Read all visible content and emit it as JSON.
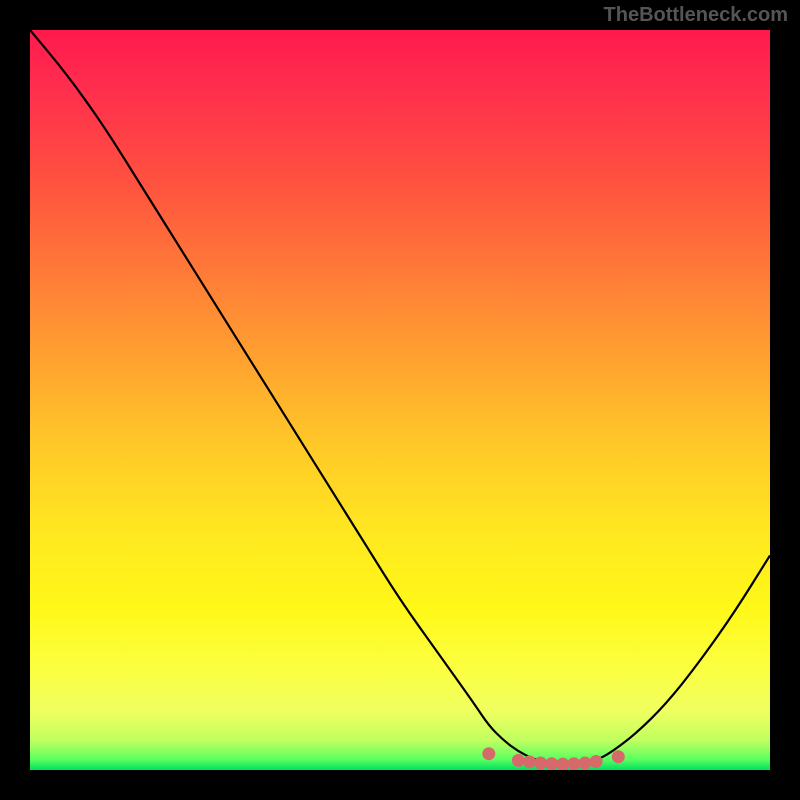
{
  "watermark": "TheBottleneck.com",
  "chart_data": {
    "type": "line",
    "title": "",
    "xlabel": "",
    "ylabel": "",
    "xlim": [
      0,
      100
    ],
    "ylim": [
      0,
      100
    ],
    "series": [
      {
        "name": "bottleneck-curve",
        "x": [
          0,
          5,
          10,
          15,
          20,
          25,
          30,
          35,
          40,
          45,
          50,
          55,
          60,
          62,
          64,
          66,
          68,
          70,
          72,
          74,
          76,
          78,
          82,
          86,
          90,
          95,
          100
        ],
        "values": [
          100,
          94,
          87,
          79,
          71,
          63,
          55,
          47,
          39,
          31,
          23,
          16,
          9,
          6,
          4,
          2.5,
          1.5,
          1,
          0.8,
          0.9,
          1.2,
          2,
          5,
          9,
          14,
          21,
          29
        ]
      }
    ],
    "marker_points": {
      "name": "optimal-range",
      "color": "#d66a6a",
      "x": [
        62,
        66,
        67.5,
        69,
        70.5,
        72,
        73.5,
        75,
        76.5,
        79.5
      ],
      "values": [
        2.2,
        1.3,
        1.1,
        0.95,
        0.85,
        0.8,
        0.85,
        0.95,
        1.15,
        1.8
      ]
    },
    "background_gradient": {
      "type": "vertical",
      "stops": [
        {
          "pos": 0,
          "color": "#ff1a4d"
        },
        {
          "pos": 0.2,
          "color": "#ff5040"
        },
        {
          "pos": 0.44,
          "color": "#ffa030"
        },
        {
          "pos": 0.68,
          "color": "#ffe820"
        },
        {
          "pos": 0.86,
          "color": "#fcff40"
        },
        {
          "pos": 0.96,
          "color": "#c0ff60"
        },
        {
          "pos": 1.0,
          "color": "#00e060"
        }
      ]
    }
  }
}
